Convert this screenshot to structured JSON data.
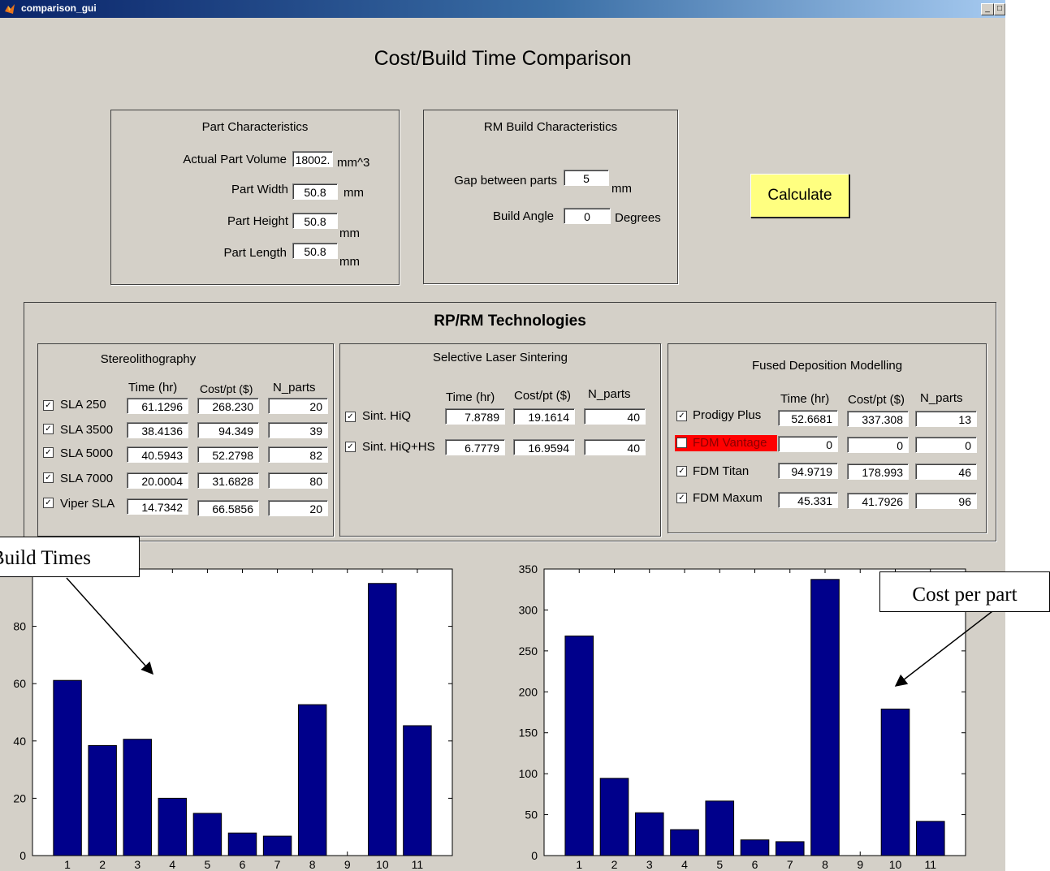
{
  "window": {
    "title": "comparison_gui"
  },
  "heading": "Cost/Build Time Comparison",
  "part": {
    "title": "Part Characteristics",
    "fields": [
      {
        "label": "Actual Part Volume",
        "value": "18002.",
        "unit": "mm^3"
      },
      {
        "label": "Part Width",
        "value": "50.8",
        "unit": "mm"
      },
      {
        "label": "Part Height",
        "value": "50.8",
        "unit": "mm"
      },
      {
        "label": "Part Length",
        "value": "50.8",
        "unit": "mm"
      }
    ]
  },
  "rm": {
    "title": "RM Build Characteristics",
    "fields": [
      {
        "label": "Gap between parts",
        "value": "5",
        "unit": "mm"
      },
      {
        "label": "Build Angle",
        "value": "0",
        "unit": "Degrees"
      }
    ]
  },
  "calculate_label": "Calculate",
  "tech": {
    "title": "RP/RM Technologies",
    "sla": {
      "title": "Stereolithography",
      "headers": [
        "Time (hr)",
        "Cost/pt ($)",
        "N_parts"
      ],
      "rows": [
        {
          "name": "SLA 250",
          "checked": true,
          "time": "61.1296",
          "cost": "268.230",
          "n": "20"
        },
        {
          "name": "SLA 3500",
          "checked": true,
          "time": "38.4136",
          "cost": "94.349",
          "n": "39"
        },
        {
          "name": "SLA 5000",
          "checked": true,
          "time": "40.5943",
          "cost": "52.2798",
          "n": "82"
        },
        {
          "name": "SLA 7000",
          "checked": true,
          "time": "20.0004",
          "cost": "31.6828",
          "n": "80"
        },
        {
          "name": "Viper SLA",
          "checked": true,
          "time": "14.7342",
          "cost": "66.5856",
          "n": "20"
        }
      ]
    },
    "sls": {
      "title": "Selective Laser Sintering",
      "headers": [
        "Time (hr)",
        "Cost/pt ($)",
        "N_parts"
      ],
      "rows": [
        {
          "name": "Sint. HiQ",
          "checked": true,
          "time": "7.8789",
          "cost": "19.1614",
          "n": "40"
        },
        {
          "name": "Sint. HiQ+HS",
          "checked": true,
          "time": "6.7779",
          "cost": "16.9594",
          "n": "40"
        }
      ]
    },
    "fdm": {
      "title": "Fused Deposition Modelling",
      "headers": [
        "Time (hr)",
        "Cost/pt ($)",
        "N_parts"
      ],
      "rows": [
        {
          "name": "Prodigy Plus",
          "checked": true,
          "time": "52.6681",
          "cost": "337.308",
          "n": "13"
        },
        {
          "name": "FDM Vantage",
          "checked": false,
          "time": "0",
          "cost": "0",
          "n": "0"
        },
        {
          "name": "FDM Titan",
          "checked": true,
          "time": "94.9719",
          "cost": "178.993",
          "n": "46"
        },
        {
          "name": "FDM Maxum",
          "checked": true,
          "time": "45.331",
          "cost": "41.7926",
          "n": "96"
        }
      ]
    }
  },
  "annotations": {
    "build_times": "Build Times",
    "cost_per_part": "Cost per part"
  },
  "colors": {
    "bar": "#00008b",
    "highlight": "#ff0000",
    "button": "#ffff80",
    "window_bg": "#d4d0c8"
  },
  "chart_data": [
    {
      "type": "bar",
      "title": "",
      "categories": [
        "1",
        "2",
        "3",
        "4",
        "5",
        "6",
        "7",
        "8",
        "9",
        "10",
        "11"
      ],
      "values": [
        61.1296,
        38.4136,
        40.5943,
        20.0004,
        14.7342,
        7.8789,
        6.7779,
        52.6681,
        0,
        94.9719,
        45.331
      ],
      "xlabel": "",
      "ylabel": "",
      "ylim": [
        0,
        100
      ],
      "yticks": [
        "0",
        "20",
        "40",
        "60",
        "80"
      ],
      "grid": false
    },
    {
      "type": "bar",
      "title": "",
      "categories": [
        "1",
        "2",
        "3",
        "4",
        "5",
        "6",
        "7",
        "8",
        "9",
        "10",
        "11"
      ],
      "values": [
        268.23,
        94.349,
        52.2798,
        31.6828,
        66.5856,
        19.1614,
        16.9594,
        337.308,
        0,
        178.993,
        41.7926
      ],
      "xlabel": "",
      "ylabel": "",
      "ylim": [
        0,
        350
      ],
      "yticks": [
        "0",
        "50",
        "100",
        "150",
        "200",
        "250",
        "300",
        "350"
      ],
      "grid": false
    }
  ]
}
